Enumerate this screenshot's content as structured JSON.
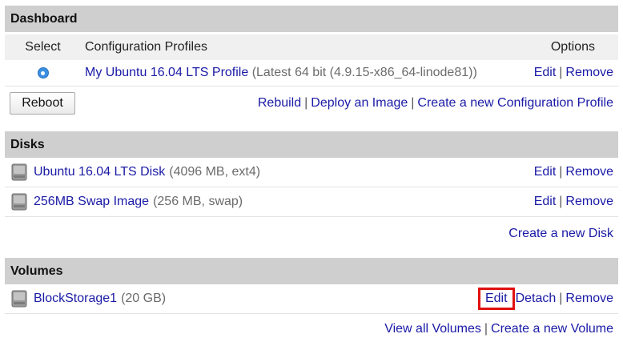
{
  "dashboard": {
    "title": "Dashboard",
    "columns": {
      "select": "Select",
      "profiles": "Configuration Profiles",
      "options": "Options"
    },
    "profile": {
      "name": "My Ubuntu 16.04 LTS Profile",
      "detail": "(Latest 64 bit (4.9.15-x86_64-linode81))",
      "edit": "Edit",
      "remove": "Remove",
      "selected": true
    },
    "reboot": "Reboot",
    "actions": {
      "rebuild": "Rebuild",
      "deploy": "Deploy an Image",
      "create_profile": "Create a new Configuration Profile"
    }
  },
  "disks": {
    "title": "Disks",
    "items": [
      {
        "name": "Ubuntu 16.04 LTS Disk",
        "detail": "(4096 MB, ext4)",
        "edit": "Edit",
        "remove": "Remove"
      },
      {
        "name": "256MB Swap Image",
        "detail": "(256 MB, swap)",
        "edit": "Edit",
        "remove": "Remove"
      }
    ],
    "create": "Create a new Disk"
  },
  "volumes": {
    "title": "Volumes",
    "items": [
      {
        "name": "BlockStorage1",
        "detail": "(20 GB)",
        "edit": "Edit",
        "detach": "Detach",
        "remove": "Remove"
      }
    ],
    "view_all": "View all Volumes",
    "create": "Create a new Volume"
  },
  "colors": {
    "header_bg": "#cfcfcf",
    "link": "#1a1aa6",
    "highlight": "#e01010"
  },
  "icons": {
    "disk": "hard-disk-icon",
    "radio": "radio-selected-icon"
  }
}
